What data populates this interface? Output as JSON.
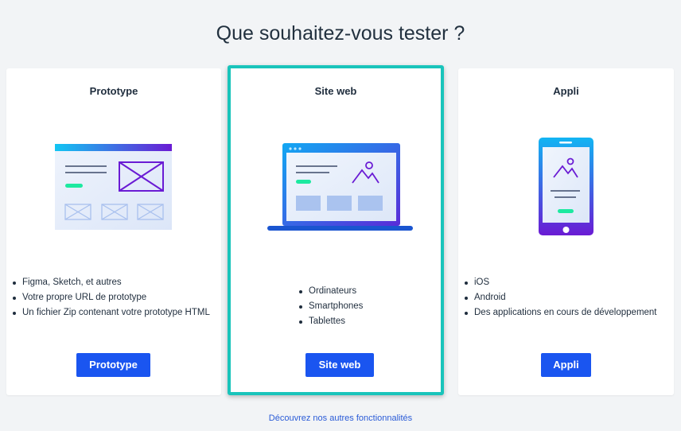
{
  "page": {
    "title": "Que souhaitez-vous tester ?"
  },
  "cards": [
    {
      "title": "Prototype",
      "features": [
        "Figma, Sketch, et autres",
        "Votre propre URL de prototype",
        "Un fichier Zip contenant votre prototype HTML"
      ],
      "button": "Prototype",
      "selected": false
    },
    {
      "title": "Site web",
      "features": [
        "Ordinateurs",
        "Smartphones",
        "Tablettes"
      ],
      "button": "Site web",
      "selected": true
    },
    {
      "title": "Appli",
      "features": [
        "iOS",
        "Android",
        "Des applications en cours de développement"
      ],
      "button": "Appli",
      "selected": false
    }
  ],
  "footer": {
    "link": "Découvrez nos autres fonctionnalités"
  },
  "colors": {
    "accent": "#1a55f0",
    "selected_border": "#19c4bb",
    "highlight": "#1de9a0",
    "gradient_purple": "#6a1bd4"
  }
}
